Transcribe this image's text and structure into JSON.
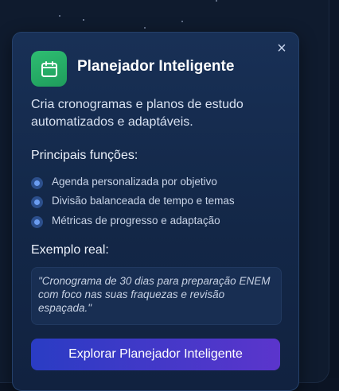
{
  "card": {
    "title": "Planejador Inteligente",
    "description": "Cria cronogramas e planos de estudo automatizados e adaptáveis.",
    "functions_label": "Principais funções:",
    "functions": [
      "Agenda personalizada por objetivo",
      "Divisão balanceada de tempo e temas",
      "Métricas de progresso e adaptação"
    ],
    "example_label": "Exemplo real:",
    "example_text": "\"Cronograma de 30 dias para preparação ENEM com foco nas suas fraquezas e revisão espaçada.\"",
    "cta_label": "Explorar Planejador Inteligente",
    "close_symbol": "×",
    "icon": "calendar-icon"
  },
  "colors": {
    "accent_green": "#22b066",
    "button_gradient_start": "#2a3cc4",
    "button_gradient_end": "#5b35cc",
    "bullet": "#6b9cf0"
  }
}
